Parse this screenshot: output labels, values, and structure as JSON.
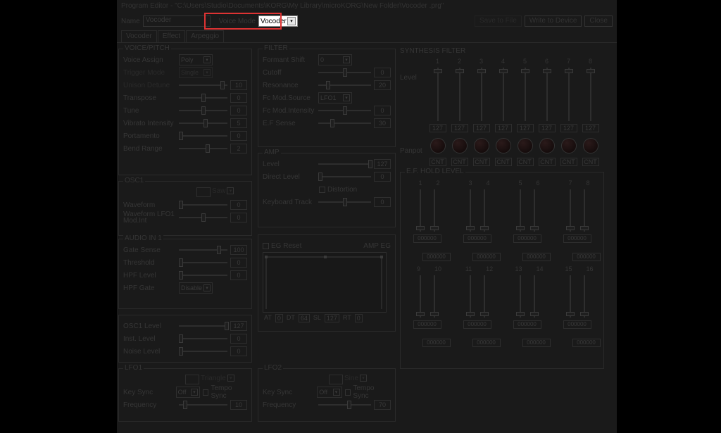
{
  "title": "Program Editor - \"C:\\Users\\Studio\\Documents\\KORG\\My Library\\microKORG\\New Folder\\Vocoder .prg\"",
  "topbar": {
    "name_label": "Name",
    "name_value": "Vocoder",
    "voice_mode_label": "Voice Mode",
    "voice_mode_value": "Vocoder",
    "save_to_file": "Save to File",
    "write_to_device": "Write to Device",
    "close": "Close"
  },
  "tabs": [
    "Vocoder",
    "Effect",
    "Arpeggio"
  ],
  "voice_pitch": {
    "title": "VOICE/PITCH",
    "voice_assign": {
      "label": "Voice Assign",
      "value": "Poly"
    },
    "trigger_mode": {
      "label": "Trigger Mode",
      "value": "Single"
    },
    "unison_detune": {
      "label": "Unison Detune",
      "value": "10"
    },
    "transpose": {
      "label": "Transpose",
      "value": "0"
    },
    "tune": {
      "label": "Tune",
      "value": "0"
    },
    "vibrato": {
      "label": "Vibrato Intensity",
      "value": "5"
    },
    "portamento": {
      "label": "Portamento",
      "value": "0"
    },
    "bend_range": {
      "label": "Bend Range",
      "value": "2"
    }
  },
  "osc1": {
    "title": "OSC1",
    "waveform_type": "Saw",
    "waveform": {
      "label": "Waveform",
      "value": "0"
    },
    "waveform_lfo1": {
      "label": "Waveform LFO1 Mod.Int",
      "value": "0"
    }
  },
  "audioin1": {
    "title": "AUDIO IN 1",
    "gate_sense": {
      "label": "Gate Sense",
      "value": "100"
    },
    "threshold": {
      "label": "Threshold",
      "value": "0"
    },
    "hpf_level": {
      "label": "HPF Level",
      "value": "0"
    },
    "hpf_gate": {
      "label": "HPF Gate",
      "value": "Disable"
    }
  },
  "mixer": {
    "osc1_level": {
      "label": "OSC1 Level",
      "value": "127"
    },
    "inst_level": {
      "label": "Inst. Level",
      "value": "0"
    },
    "noise_level": {
      "label": "Noise Level",
      "value": "0"
    }
  },
  "filter": {
    "title": "FILTER",
    "formant_shift": {
      "label": "Formant Shift",
      "value": "0"
    },
    "cutoff": {
      "label": "Cutoff",
      "value": "0"
    },
    "resonance": {
      "label": "Resonance",
      "value": "20"
    },
    "fc_mod_source": {
      "label": "Fc Mod.Source",
      "value": "LFO1"
    },
    "fc_mod_int": {
      "label": "Fc Mod.Intensity",
      "value": "0"
    },
    "ef_sense": {
      "label": "E.F Sense",
      "value": "30"
    }
  },
  "amp": {
    "title": "AMP",
    "level": {
      "label": "Level",
      "value": "127"
    },
    "direct_level": {
      "label": "Direct Level",
      "value": "0"
    },
    "distortion": {
      "label": "Distortion",
      "checked": false
    },
    "keyboard_track": {
      "label": "Keyboard Track",
      "value": "0"
    }
  },
  "amp_eg": {
    "title": "AMP EG",
    "eg_reset": "EG Reset",
    "at": "0",
    "dt": "64",
    "sl": "127",
    "rt": "0"
  },
  "lfo1": {
    "title": "LFO1",
    "wave": "Triangle",
    "key_sync": {
      "label": "Key Sync",
      "value": "Off"
    },
    "tempo_sync": "Tempo Sync",
    "frequency": {
      "label": "Frequency",
      "value": "10"
    }
  },
  "lfo2": {
    "title": "LFO2",
    "wave": "Sine",
    "key_sync": {
      "label": "Key Sync",
      "value": "Off"
    },
    "tempo_sync": "Tempo Sync",
    "frequency": {
      "label": "Frequency",
      "value": "70"
    }
  },
  "synth": {
    "title": "SYNTHESIS FILTER",
    "level_label": "Level",
    "panpot_label": "Panpot",
    "channels": [
      "1",
      "2",
      "3",
      "4",
      "5",
      "6",
      "7",
      "8"
    ],
    "level_values": [
      "127",
      "127",
      "127",
      "127",
      "127",
      "127",
      "127",
      "127"
    ],
    "pan_values": [
      "CNT",
      "CNT",
      "CNT",
      "CNT",
      "CNT",
      "CNT",
      "CNT",
      "CNT"
    ],
    "efhold_title": "E.F. HOLD LEVEL",
    "ef_top_nums": [
      "1",
      "3",
      "5",
      "7"
    ],
    "ef_top_nums_offset": [
      "2",
      "4",
      "6",
      "8"
    ],
    "ef_top_vals": [
      "000000",
      "000000",
      "000000",
      "000000"
    ],
    "ef_top_vals_offset": [
      "000000",
      "000000",
      "000000",
      "000000"
    ],
    "ef_bot_nums": [
      "9",
      "11",
      "13",
      "15"
    ],
    "ef_bot_nums_offset": [
      "10",
      "12",
      "14",
      "16"
    ],
    "ef_bot_vals": [
      "000000",
      "000000",
      "000000",
      "000000"
    ],
    "ef_bot_vals_offset": [
      "000000",
      "000000",
      "000000",
      "000000"
    ]
  }
}
